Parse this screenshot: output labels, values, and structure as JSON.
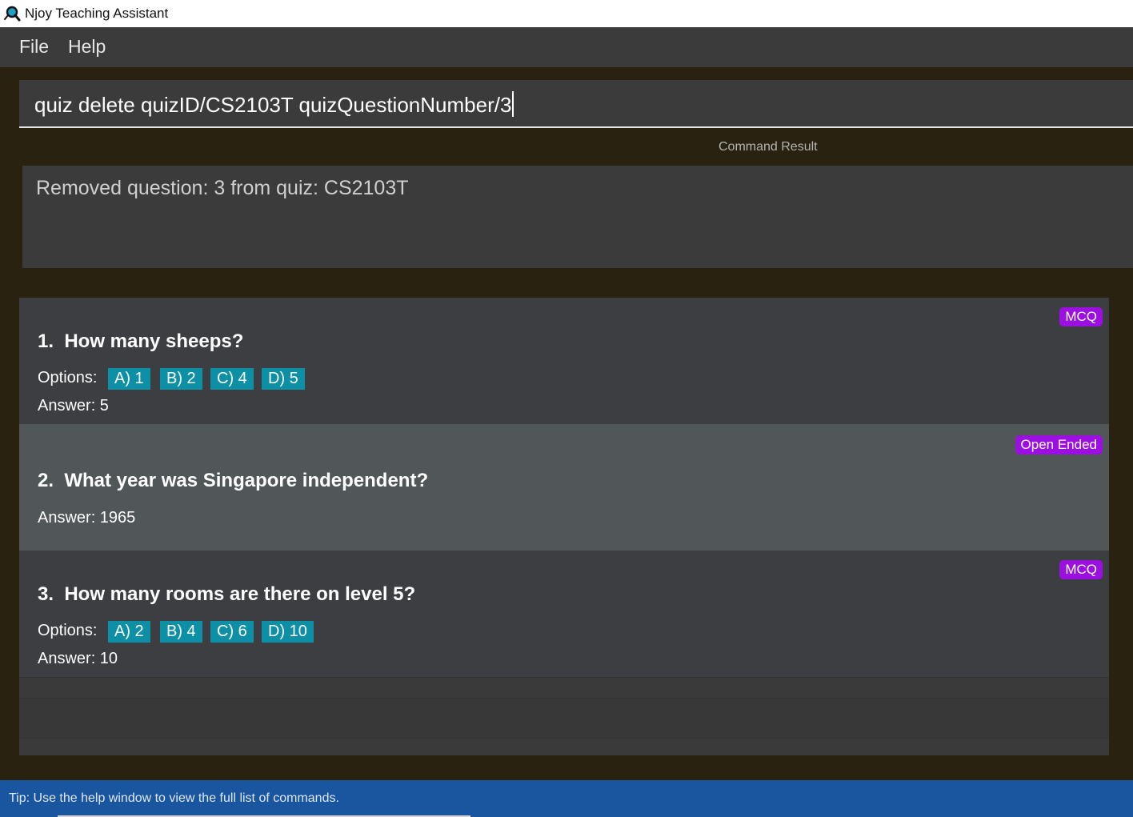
{
  "window": {
    "title": "Njoy Teaching Assistant",
    "icon": "magnifier-app-icon"
  },
  "menu": {
    "file": "File",
    "help": "Help"
  },
  "command": {
    "value": "quiz delete quizID/CS2103T quizQuestionNumber/3"
  },
  "result": {
    "label": "Command Result",
    "text": "Removed question: 3 from quiz: CS2103T"
  },
  "questions": [
    {
      "title": "1.  How many sheeps?",
      "type": "MCQ",
      "options_label": "Options:",
      "options": [
        "A) 1",
        "B) 2",
        "C) 4",
        "D) 5"
      ],
      "answer": "Answer: 5"
    },
    {
      "title": "2.  What year was Singapore independent?",
      "type": "Open Ended",
      "answer": "Answer: 1965"
    },
    {
      "title": "3.  How many rooms are there on level 5?",
      "type": "MCQ",
      "options_label": "Options:",
      "options": [
        "A) 2",
        "B) 4",
        "C) 6",
        "D) 10"
      ],
      "answer": "Answer: 10"
    }
  ],
  "status": {
    "tip": "Tip: Use the help window to view the full list of commands."
  },
  "colors": {
    "badge": "#9b0fe0",
    "option": "#0d8fa6",
    "statusbar": "#1a55a0",
    "background": "#2a2210"
  }
}
